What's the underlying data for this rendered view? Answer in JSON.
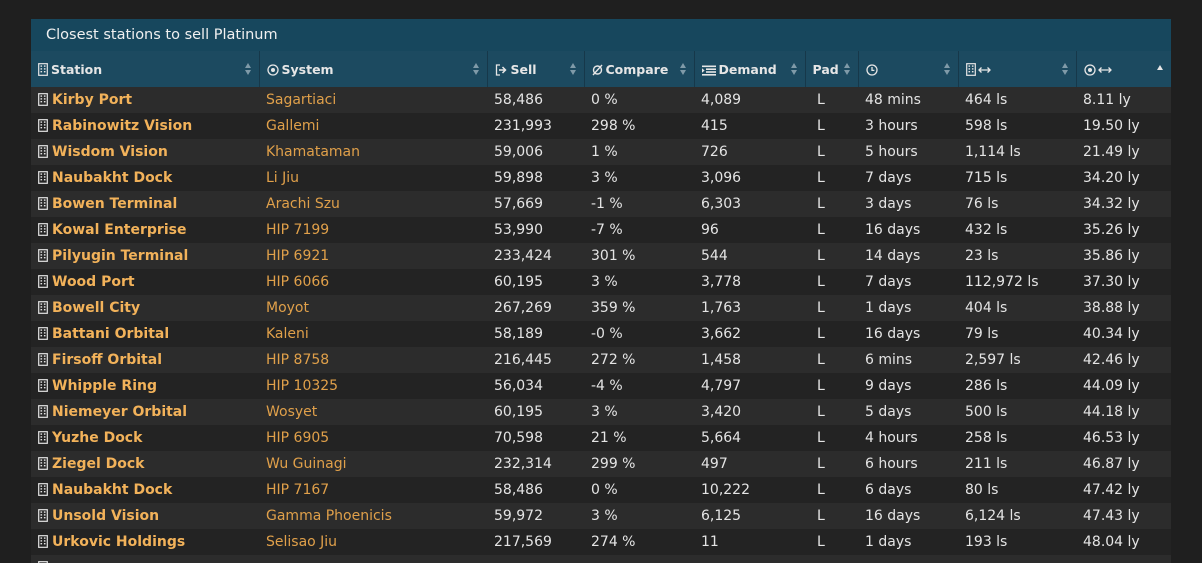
{
  "caption": "Closest stations to sell Platinum",
  "columns": [
    {
      "key": "station",
      "label": "Station",
      "icon": "building-icon"
    },
    {
      "key": "system",
      "label": "System",
      "icon": "target-icon"
    },
    {
      "key": "sell",
      "label": "Sell",
      "icon": "sell-icon"
    },
    {
      "key": "compare",
      "label": "Compare",
      "icon": "diameter-icon"
    },
    {
      "key": "demand",
      "label": "Demand",
      "icon": "list-icon"
    },
    {
      "key": "pad",
      "label": "Pad",
      "icon": ""
    },
    {
      "key": "updated",
      "label": "",
      "icon": "clock-icon"
    },
    {
      "key": "station_distance",
      "label": "",
      "icon": "building-distance-icon"
    },
    {
      "key": "system_distance",
      "label": "",
      "icon": "target-distance-icon"
    }
  ],
  "rows": [
    {
      "station": "Kirby Port",
      "system": "Sagartiaci",
      "sell": "58,486",
      "compare": "0 %",
      "demand": "4,089",
      "pad": "L",
      "updated": "48 mins",
      "station_distance": "464 ls",
      "system_distance": "8.11 ly"
    },
    {
      "station": "Rabinowitz Vision",
      "system": "Gallemi",
      "sell": "231,993",
      "compare": "298 %",
      "demand": "415",
      "pad": "L",
      "updated": "3 hours",
      "station_distance": "598 ls",
      "system_distance": "19.50 ly"
    },
    {
      "station": "Wisdom Vision",
      "system": "Khamataman",
      "sell": "59,006",
      "compare": "1 %",
      "demand": "726",
      "pad": "L",
      "updated": "5 hours",
      "station_distance": "1,114 ls",
      "system_distance": "21.49 ly"
    },
    {
      "station": "Naubakht Dock",
      "system": "Li Jiu",
      "sell": "59,898",
      "compare": "3 %",
      "demand": "3,096",
      "pad": "L",
      "updated": "7 days",
      "station_distance": "715 ls",
      "system_distance": "34.20 ly"
    },
    {
      "station": "Bowen Terminal",
      "system": "Arachi Szu",
      "sell": "57,669",
      "compare": "-1 %",
      "demand": "6,303",
      "pad": "L",
      "updated": "3 days",
      "station_distance": "76 ls",
      "system_distance": "34.32 ly"
    },
    {
      "station": "Kowal Enterprise",
      "system": "HIP 7199",
      "sell": "53,990",
      "compare": "-7 %",
      "demand": "96",
      "pad": "L",
      "updated": "16 days",
      "station_distance": "432 ls",
      "system_distance": "35.26 ly"
    },
    {
      "station": "Pilyugin Terminal",
      "system": "HIP 6921",
      "sell": "233,424",
      "compare": "301 %",
      "demand": "544",
      "pad": "L",
      "updated": "14 days",
      "station_distance": "23 ls",
      "system_distance": "35.86 ly"
    },
    {
      "station": "Wood Port",
      "system": "HIP 6066",
      "sell": "60,195",
      "compare": "3 %",
      "demand": "3,778",
      "pad": "L",
      "updated": "7 days",
      "station_distance": "112,972 ls",
      "system_distance": "37.30 ly"
    },
    {
      "station": "Bowell City",
      "system": "Moyot",
      "sell": "267,269",
      "compare": "359 %",
      "demand": "1,763",
      "pad": "L",
      "updated": "1 days",
      "station_distance": "404 ls",
      "system_distance": "38.88 ly"
    },
    {
      "station": "Battani Orbital",
      "system": "Kaleni",
      "sell": "58,189",
      "compare": "-0 %",
      "demand": "3,662",
      "pad": "L",
      "updated": "16 days",
      "station_distance": "79 ls",
      "system_distance": "40.34 ly"
    },
    {
      "station": "Firsoff Orbital",
      "system": "HIP 8758",
      "sell": "216,445",
      "compare": "272 %",
      "demand": "1,458",
      "pad": "L",
      "updated": "6 mins",
      "station_distance": "2,597 ls",
      "system_distance": "42.46 ly"
    },
    {
      "station": "Whipple Ring",
      "system": "HIP 10325",
      "sell": "56,034",
      "compare": "-4 %",
      "demand": "4,797",
      "pad": "L",
      "updated": "9 days",
      "station_distance": "286 ls",
      "system_distance": "44.09 ly"
    },
    {
      "station": "Niemeyer Orbital",
      "system": "Wosyet",
      "sell": "60,195",
      "compare": "3 %",
      "demand": "3,420",
      "pad": "L",
      "updated": "5 days",
      "station_distance": "500 ls",
      "system_distance": "44.18 ly"
    },
    {
      "station": "Yuzhe Dock",
      "system": "HIP 6905",
      "sell": "70,598",
      "compare": "21 %",
      "demand": "5,664",
      "pad": "L",
      "updated": "4 hours",
      "station_distance": "258 ls",
      "system_distance": "46.53 ly"
    },
    {
      "station": "Ziegel Dock",
      "system": "Wu Guinagi",
      "sell": "232,314",
      "compare": "299 %",
      "demand": "497",
      "pad": "L",
      "updated": "6 hours",
      "station_distance": "211 ls",
      "system_distance": "46.87 ly"
    },
    {
      "station": "Naubakht Dock",
      "system": "HIP 7167",
      "sell": "58,486",
      "compare": "0 %",
      "demand": "10,222",
      "pad": "L",
      "updated": "6 days",
      "station_distance": "80 ls",
      "system_distance": "47.42 ly"
    },
    {
      "station": "Unsold Vision",
      "system": "Gamma Phoenicis",
      "sell": "59,972",
      "compare": "3 %",
      "demand": "6,125",
      "pad": "L",
      "updated": "16 days",
      "station_distance": "6,124 ls",
      "system_distance": "47.43 ly"
    },
    {
      "station": "Urkovic Holdings",
      "system": "Selisao Jiu",
      "sell": "217,569",
      "compare": "274 %",
      "demand": "11",
      "pad": "L",
      "updated": "1 days",
      "station_distance": "193 ls",
      "system_distance": "48.04 ly"
    },
    {
      "station": "",
      "system": "",
      "sell": "",
      "compare": "",
      "demand": "",
      "pad": "",
      "updated": "",
      "station_distance": "",
      "system_distance": ""
    }
  ],
  "sorted_column": "system_distance",
  "sort_direction": "ascending",
  "colors": {
    "station_text": "#f2b25a",
    "system_text": "#e0a04a",
    "header_bg": "#1c4a60",
    "caption_bg": "#17475d"
  }
}
